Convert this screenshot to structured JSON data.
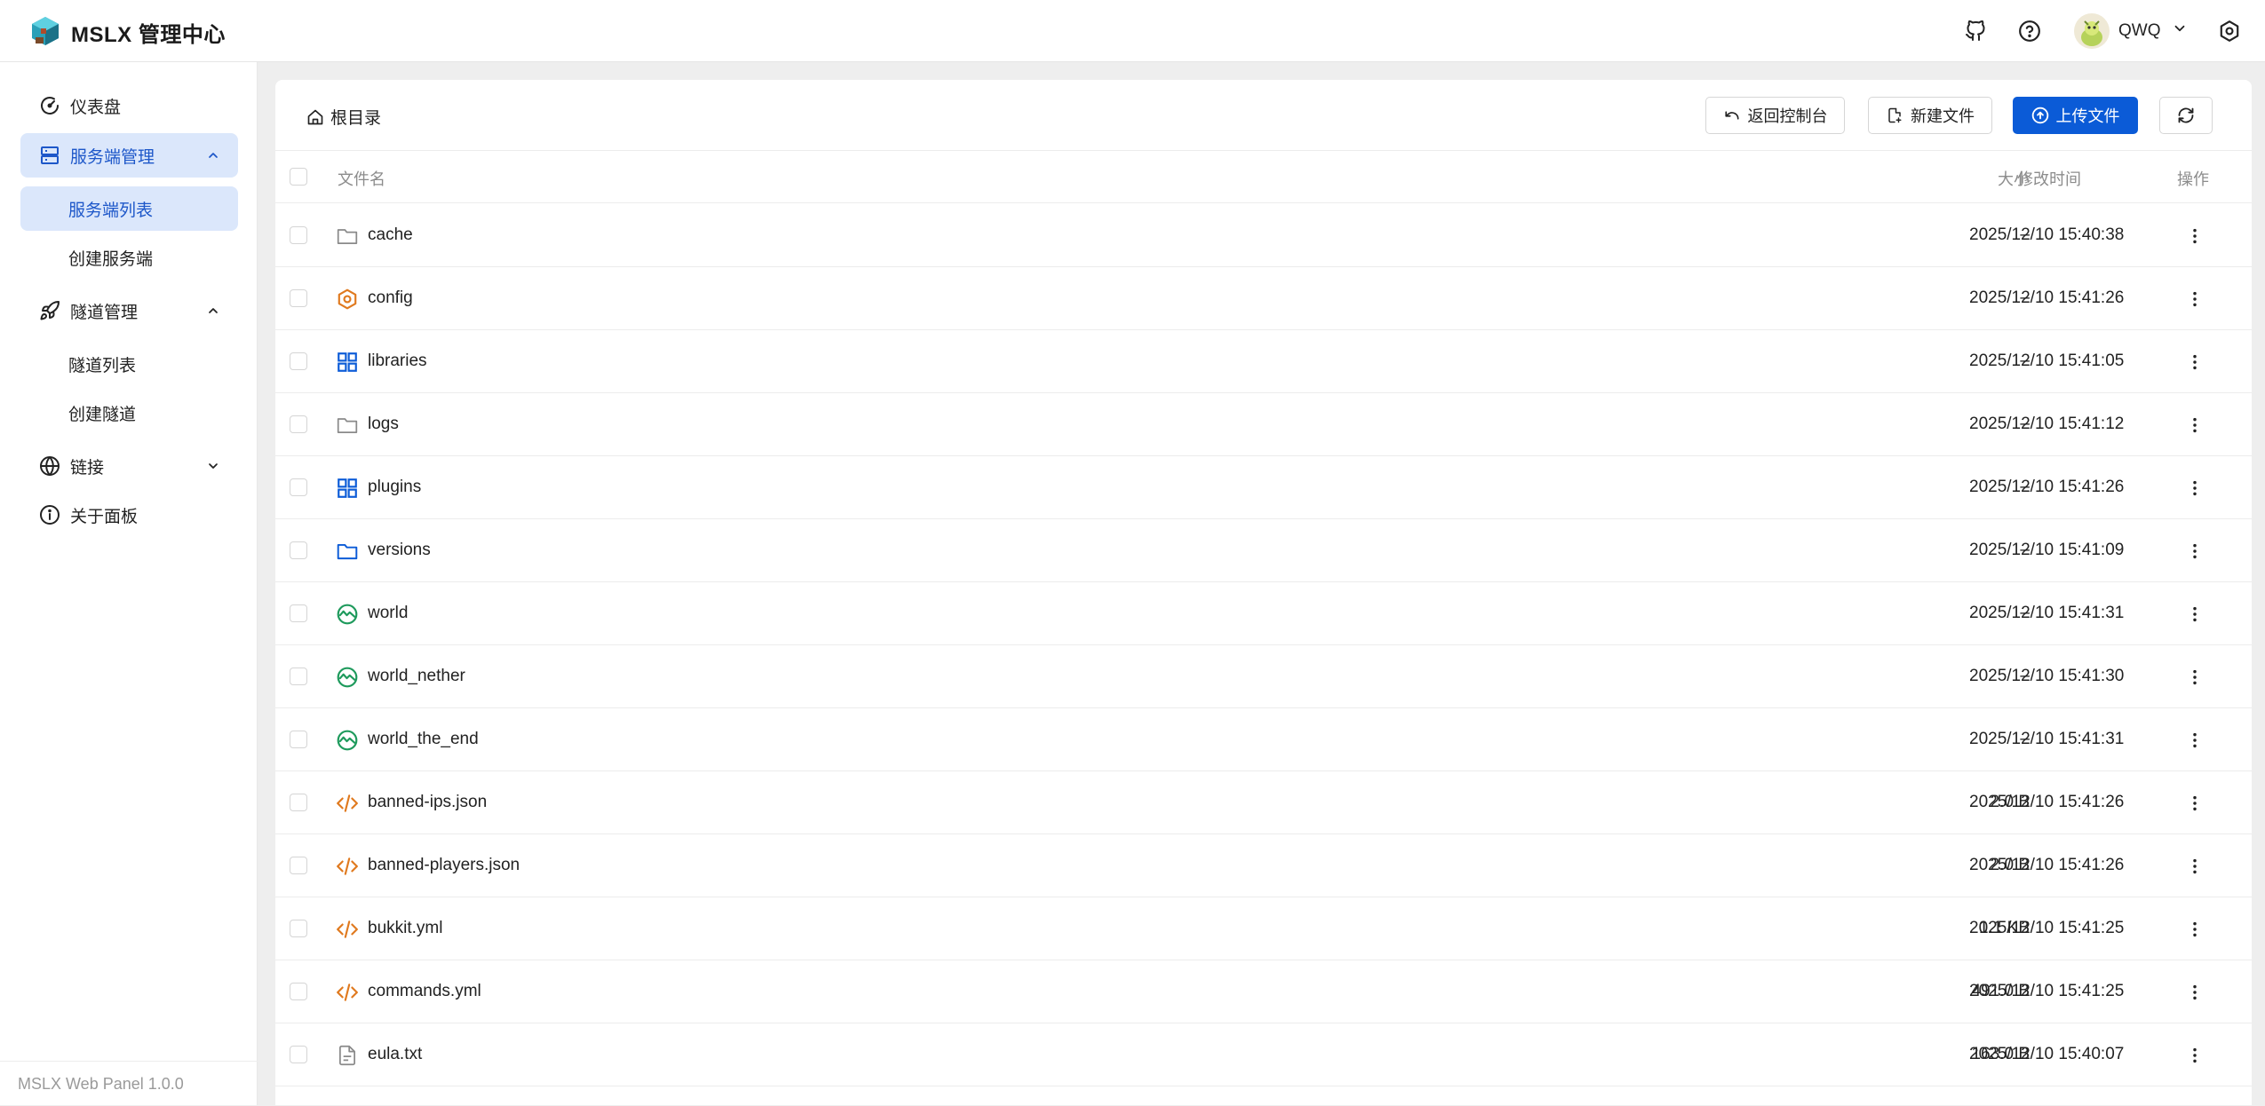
{
  "header": {
    "app_title": "MSLX 管理中心",
    "user_name": "QWQ",
    "icons": [
      "github-icon",
      "help-icon",
      "settings-icon"
    ]
  },
  "sidebar": {
    "items": [
      {
        "label": "仪表盘",
        "icon": "dashboard-icon"
      },
      {
        "label": "服务端管理",
        "icon": "server-icon",
        "expanded": true
      },
      {
        "label": "服务端列表",
        "selected": true
      },
      {
        "label": "创建服务端"
      },
      {
        "label": "隧道管理",
        "icon": "rocket-icon",
        "expanded": true
      },
      {
        "label": "隧道列表"
      },
      {
        "label": "创建隧道"
      },
      {
        "label": "链接",
        "icon": "globe-icon",
        "expanded": false
      },
      {
        "label": "关于面板",
        "icon": "info-icon"
      }
    ],
    "version": "MSLX Web Panel 1.0.0"
  },
  "toolbar": {
    "breadcrumb": "根目录",
    "back_label": "返回控制台",
    "new_file_label": "新建文件",
    "upload_label": "上传文件"
  },
  "table": {
    "columns": {
      "name": "文件名",
      "size": "大小",
      "modified": "修改时间",
      "actions": "操作"
    },
    "rows": [
      {
        "name": "cache",
        "size": "–",
        "modified": "2025/12/10 15:40:38",
        "icon": "folder-icon"
      },
      {
        "name": "config",
        "size": "–",
        "modified": "2025/12/10 15:41:26",
        "icon": "config-folder-icon"
      },
      {
        "name": "libraries",
        "size": "–",
        "modified": "2025/12/10 15:41:05",
        "icon": "libraries-folder-icon"
      },
      {
        "name": "logs",
        "size": "–",
        "modified": "2025/12/10 15:41:12",
        "icon": "folder-icon"
      },
      {
        "name": "plugins",
        "size": "–",
        "modified": "2025/12/10 15:41:26",
        "icon": "plugins-folder-icon"
      },
      {
        "name": "versions",
        "size": "–",
        "modified": "2025/12/10 15:41:09",
        "icon": "versions-folder-icon"
      },
      {
        "name": "world",
        "size": "–",
        "modified": "2025/12/10 15:41:31",
        "icon": "world-icon"
      },
      {
        "name": "world_nether",
        "size": "–",
        "modified": "2025/12/10 15:41:30",
        "icon": "world-icon"
      },
      {
        "name": "world_the_end",
        "size": "–",
        "modified": "2025/12/10 15:41:31",
        "icon": "world-icon"
      },
      {
        "name": "banned-ips.json",
        "size": "2.0 B",
        "modified": "2025/12/10 15:41:26",
        "icon": "code-file-icon"
      },
      {
        "name": "banned-players.json",
        "size": "2.0 B",
        "modified": "2025/12/10 15:41:26",
        "icon": "code-file-icon"
      },
      {
        "name": "bukkit.yml",
        "size": "1.1 KB",
        "modified": "2025/12/10 15:41:25",
        "icon": "code-file-icon"
      },
      {
        "name": "commands.yml",
        "size": "491.0 B",
        "modified": "2025/12/10 15:41:25",
        "icon": "code-file-icon"
      },
      {
        "name": "eula.txt",
        "size": "163.0 B",
        "modified": "2025/12/10 15:40:07",
        "icon": "text-file-icon"
      }
    ]
  },
  "colors": {
    "accent": "#0b5bd7",
    "active_bg": "#dbe7fb",
    "config_orange": "#e07a1f",
    "world_green": "#1e9a5c",
    "code_orange": "#e07a1f"
  }
}
